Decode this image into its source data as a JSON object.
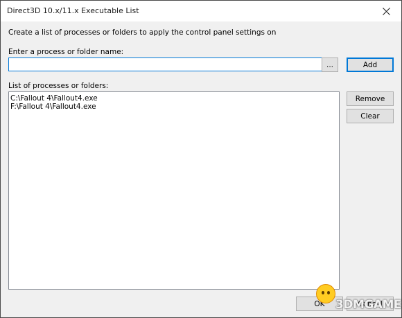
{
  "window": {
    "title": "Direct3D 10.x/11.x Executable List"
  },
  "description": "Create a list of processes or folders to apply the control panel settings on",
  "process_input": {
    "label": "Enter a process or folder name:",
    "value": "",
    "browse_label": "...",
    "add_label": "Add"
  },
  "process_list": {
    "label": "List of processes or folders:",
    "items": [
      "C:\\Fallout 4\\Fallout4.exe",
      "F:\\Fallout 4\\Fallout4.exe"
    ],
    "remove_label": "Remove",
    "clear_label": "Clear"
  },
  "footer": {
    "ok_label": "OK",
    "cancel_label": "Cancel"
  },
  "watermark": {
    "text": "3DMGAME"
  },
  "colors": {
    "focus_border": "#0078d7",
    "button_face": "#e1e1e1",
    "dialog_bg": "#f0f0f0"
  }
}
